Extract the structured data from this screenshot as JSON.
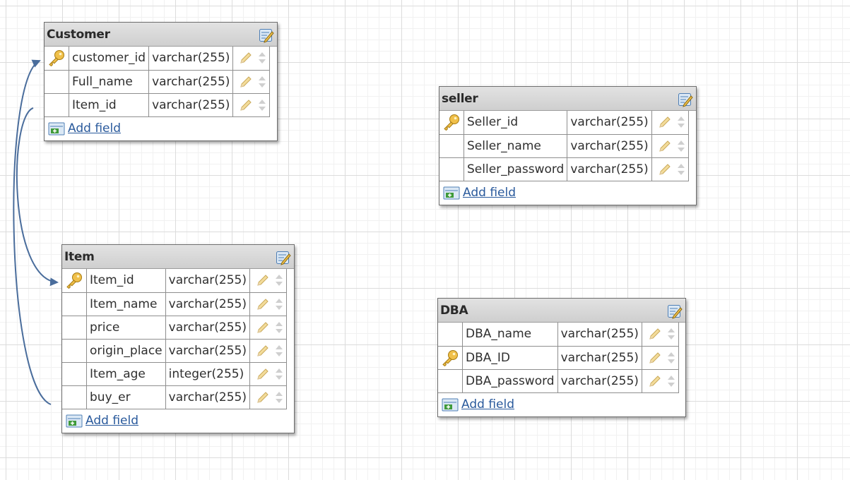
{
  "tables": [
    {
      "name": "Customer",
      "fields": [
        {
          "name": "customer_id",
          "type": "varchar(255)",
          "primary_key": true
        },
        {
          "name": "Full_name",
          "type": "varchar(255)",
          "primary_key": false
        },
        {
          "name": "Item_id",
          "type": "varchar(255)",
          "primary_key": false
        }
      ],
      "add_field_label": "Add field"
    },
    {
      "name": "seller",
      "fields": [
        {
          "name": "Seller_id",
          "type": "varchar(255)",
          "primary_key": true
        },
        {
          "name": "Seller_name",
          "type": "varchar(255)",
          "primary_key": false
        },
        {
          "name": "Seller_password",
          "type": "varchar(255)",
          "primary_key": false
        }
      ],
      "add_field_label": "Add field"
    },
    {
      "name": "Item",
      "fields": [
        {
          "name": "Item_id",
          "type": "varchar(255)",
          "primary_key": true
        },
        {
          "name": "Item_name",
          "type": "varchar(255)",
          "primary_key": false
        },
        {
          "name": "price",
          "type": "varchar(255)",
          "primary_key": false
        },
        {
          "name": "origin_place",
          "type": "varchar(255)",
          "primary_key": false
        },
        {
          "name": "Item_age",
          "type": "integer(255)",
          "primary_key": false
        },
        {
          "name": "buy_er",
          "type": "varchar(255)",
          "primary_key": false
        }
      ],
      "add_field_label": "Add field"
    },
    {
      "name": "DBA",
      "fields": [
        {
          "name": "DBA_name",
          "type": "varchar(255)",
          "primary_key": false
        },
        {
          "name": "DBA_ID",
          "type": "varchar(255)",
          "primary_key": true
        },
        {
          "name": "DBA_password",
          "type": "varchar(255)",
          "primary_key": false
        }
      ],
      "add_field_label": "Add field"
    }
  ],
  "relations": [
    {
      "from": "Customer.Item_id",
      "to": "Item.Item_id"
    },
    {
      "from": "Item.buy_er",
      "to": "Customer.customer_id"
    }
  ],
  "icons": {
    "primary_key": "key-icon",
    "edit_table": "edit-table-icon",
    "edit_field": "pencil-icon",
    "reorder_field": "up-down-arrows-icon",
    "add_field": "add-field-icon"
  },
  "colors": {
    "relation_line": "#4a6d9c",
    "link": "#2a5a9c",
    "header": "#d6d6d6",
    "key": "#e0a820"
  }
}
